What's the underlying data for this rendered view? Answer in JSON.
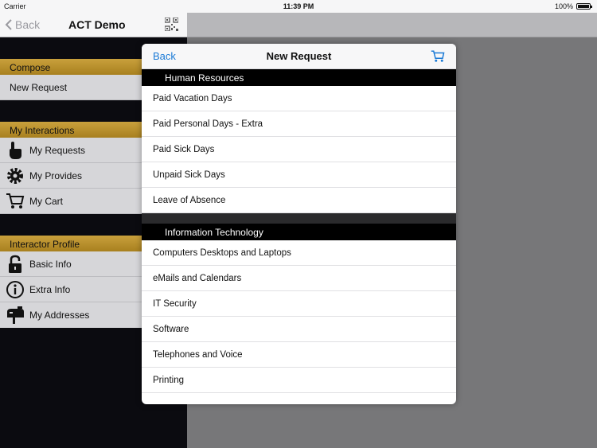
{
  "status": {
    "carrier": "Carrier",
    "time": "11:39 PM",
    "battery": "100%"
  },
  "nav": {
    "back_label": "Back",
    "title": "ACT Demo"
  },
  "sidebar": {
    "compose": {
      "header": "Compose",
      "items": [
        {
          "label": "New Request"
        }
      ]
    },
    "interactions": {
      "header": "My Interactions",
      "items": [
        {
          "label": "My Requests",
          "icon": "pointer-hand-icon"
        },
        {
          "label": "My Provides",
          "icon": "gear-icon"
        },
        {
          "label": "My Cart",
          "icon": "cart-icon"
        }
      ]
    },
    "profile": {
      "header": "Interactor Profile",
      "items": [
        {
          "label": "Basic Info",
          "icon": "lock-icon"
        },
        {
          "label": "Extra Info",
          "icon": "info-icon"
        },
        {
          "label": "My Addresses",
          "icon": "mailbox-icon"
        }
      ]
    }
  },
  "modal": {
    "back_label": "Back",
    "title": "New Request",
    "groups": [
      {
        "header": "Human Resources",
        "items": [
          "Paid Vacation Days",
          "Paid Personal Days - Extra",
          "Paid Sick Days",
          "Unpaid Sick Days",
          "Leave of Absence"
        ]
      },
      {
        "header": "Information Technology",
        "items": [
          "Computers Desktops and Laptops",
          "eMails and Calendars",
          "IT Security",
          "Software",
          "Telephones and Voice",
          "Printing"
        ]
      }
    ]
  },
  "colors": {
    "accent": "#1a7ad6",
    "section": "#c9a03c"
  }
}
